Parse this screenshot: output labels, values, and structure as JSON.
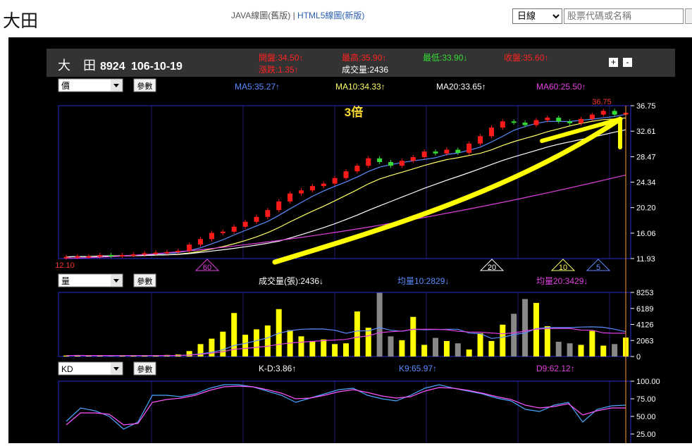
{
  "page": {
    "title": "大田",
    "links": {
      "java": "JAVA線圖(舊版)",
      "separator": "|",
      "html5": "HTML5線圖(新版)"
    },
    "period_select": {
      "selected": "日線",
      "options": [
        "日線"
      ]
    },
    "search": {
      "placeholder": "股票代碼或名稱"
    }
  },
  "header": {
    "stock_name": "大　田",
    "code": "8924",
    "date": "106-10-19",
    "open": "開盤:34.50↑",
    "high": "最高:35.90↑",
    "low": "最低:33.90↓",
    "close": "收盤:35.60↑",
    "change": "漲跌:1.35↑",
    "volume": "成交量:2436",
    "plus": "+",
    "minus": "-"
  },
  "colors": {
    "up": "#ff1a1a",
    "down": "#33dd33",
    "ma5": "#5b8cff",
    "ma10": "#ffff66",
    "ma20": "#ffffff",
    "ma60": "#e040e0",
    "volume_bar": "#ffff00",
    "volume_bar_down": "#888888",
    "k_line": "#4aa6ff",
    "d_line": "#ff55ff",
    "grid": "#2b2bd0",
    "annotation": "#ffff00"
  },
  "price_panel": {
    "indicator_select": "價",
    "params_button": "參數",
    "ma5": "MA5:35.27↑",
    "ma10": "MA10:34.33↑",
    "ma20": "MA20:33.65↑",
    "ma60": "MA60:25.50↑",
    "annotation": "3倍",
    "high_label": "36.75",
    "low_label": "12.10",
    "markers": [
      "60",
      "20",
      "10",
      "5"
    ]
  },
  "volume_panel": {
    "indicator_select": "量",
    "params_button": "參數",
    "volume": "成交量(張):2436↓",
    "avg10": "均量10:2829↓",
    "avg20": "均量20:3429↓"
  },
  "kd_panel": {
    "indicator_select": "KD",
    "params_button": "參數",
    "kd": "K-D:3.86↑",
    "k9": "K9:65.97↑",
    "d9": "D9:62.12↑"
  },
  "chart_data": [
    {
      "type": "candlestick",
      "title": "大田 8924 106-10-19",
      "y_ticks": [
        "36.75",
        "32.61",
        "28.47",
        "24.34",
        "20.20",
        "16.06",
        "11.93"
      ],
      "ylim": [
        11.93,
        36.75
      ],
      "close": [
        12.2,
        12.3,
        12.3,
        12.5,
        12.4,
        12.5,
        12.6,
        12.8,
        12.9,
        13.0,
        13.2,
        14.2,
        15.1,
        16.1,
        16.3,
        17.1,
        17.9,
        18.7,
        19.8,
        21.2,
        22.5,
        23.0,
        23.7,
        24.1,
        25.0,
        26.1,
        27.0,
        28.2,
        27.6,
        27.0,
        27.8,
        28.4,
        29.3,
        29.0,
        29.6,
        29.1,
        30.6,
        31.8,
        33.2,
        34.2,
        34.0,
        33.6,
        34.4,
        34.8,
        34.2,
        33.9,
        34.6,
        35.3,
        35.9,
        35.3,
        35.6
      ],
      "series": [
        {
          "name": "MA5",
          "value": 35.27
        },
        {
          "name": "MA10",
          "value": 34.33
        },
        {
          "name": "MA20",
          "value": 33.65
        },
        {
          "name": "MA60",
          "value": 25.5
        }
      ]
    },
    {
      "type": "bar",
      "title": "成交量(張)",
      "y_ticks": [
        "8253",
        "6189",
        "4126",
        "2063",
        "0"
      ],
      "ylim": [
        0,
        8253
      ],
      "values": [
        120,
        150,
        100,
        130,
        110,
        100,
        90,
        120,
        140,
        200,
        260,
        700,
        1600,
        2300,
        3200,
        5600,
        2800,
        3500,
        4000,
        6100,
        3400,
        2600,
        2000,
        2200,
        1600,
        1700,
        5800,
        3700,
        8200,
        2600,
        2100,
        5100,
        1500,
        2400,
        2000,
        1700,
        900,
        3000,
        2000,
        4100,
        5500,
        7400,
        6900,
        3900,
        1900,
        1700,
        1500,
        3300,
        1400,
        1600,
        2436
      ]
    },
    {
      "type": "line",
      "title": "KD",
      "y_ticks": [
        "100.00",
        "75.00",
        "50.00",
        "25.00"
      ],
      "ylim": [
        0,
        100
      ],
      "series": [
        {
          "name": "K9",
          "values": [
            43,
            62,
            58,
            50,
            32,
            42,
            80,
            80,
            78,
            82,
            90,
            95,
            95,
            92,
            86,
            80,
            70,
            76,
            82,
            88,
            90,
            80,
            75,
            72,
            80,
            90,
            95,
            90,
            86,
            82,
            76,
            72,
            60,
            57,
            66,
            70,
            42,
            60,
            65,
            66
          ]
        },
        {
          "name": "D9",
          "values": [
            38,
            55,
            55,
            53,
            38,
            40,
            70,
            74,
            76,
            80,
            87,
            92,
            93,
            92,
            88,
            83,
            75,
            76,
            80,
            85,
            88,
            84,
            79,
            76,
            78,
            86,
            91,
            90,
            87,
            83,
            78,
            74,
            66,
            62,
            64,
            68,
            52,
            58,
            62,
            62
          ]
        }
      ]
    }
  ]
}
